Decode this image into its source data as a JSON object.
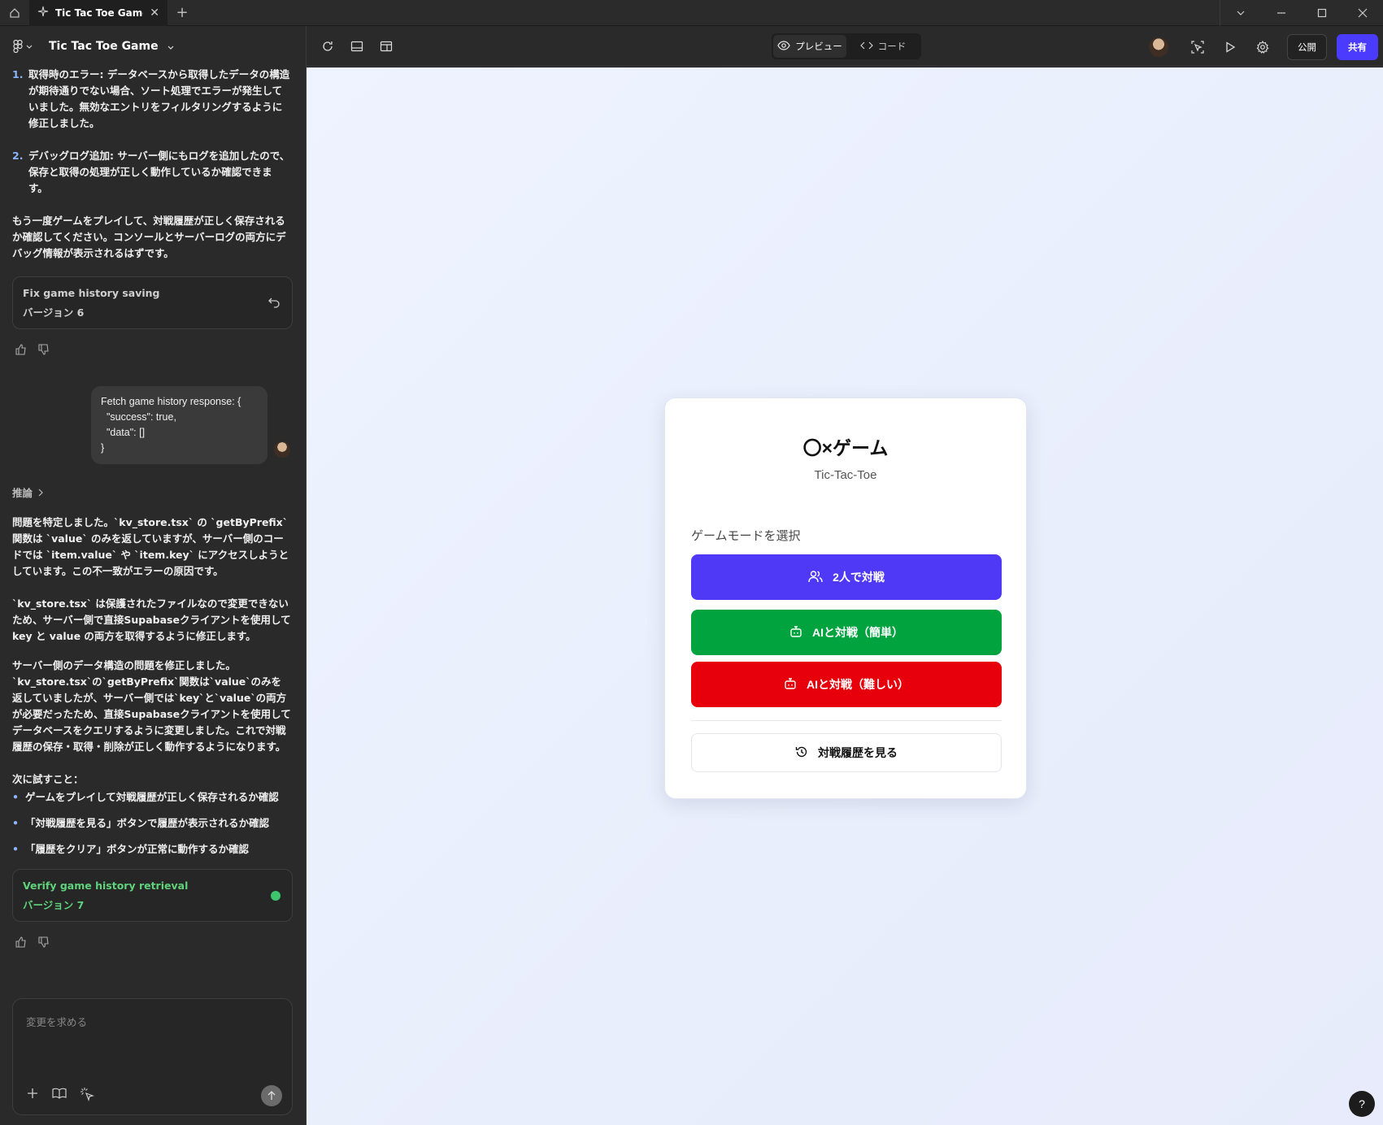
{
  "window": {
    "tab_title": "Tic Tac Toe Game"
  },
  "sidebar": {
    "project_name": "Tic Tac Toe Game",
    "messages": {
      "list1_num": "1.",
      "list1_strong": "取得時のエラー",
      "list1_text": ": データベースから取得したデータの構造が期待通りでない場合、ソート処理でエラーが発生していました。無効なエントリをフィルタリングするように修正しました。",
      "list2_num": "2.",
      "list2_strong": "デバッグログ追加",
      "list2_text": ": サーバー側にもログを追加したので、保存と取得の処理が正しく動作しているか確認できます。",
      "para1": "もう一度ゲームをプレイして、対戦履歴が正しく保存されるか確認してください。コンソールとサーバーログの両方にデバッグ情報が表示されるはずです。"
    },
    "version6": {
      "title": "Fix game history saving",
      "version": "バージョン 6"
    },
    "user_message": "Fetch game history response: {\n  \"success\": true,\n  \"data\": []\n}",
    "reasoning_label": "推論",
    "reply": {
      "p1": "問題を特定しました。`kv_store.tsx` の `getByPrefix` 関数は `value` のみを返していますが、サーバー側のコードでは `item.value` や `item.key` にアクセスしようとしています。この不一致がエラーの原因です。",
      "p2": "`kv_store.tsx` は保護されたファイルなので変更できないため、サーバー側で直接Supabaseクライアントを使用してkey と value の両方を取得するように修正します。",
      "p3": "サーバー側のデータ構造の問題を修正しました。`kv_store.tsx`の`getByPrefix`関数は`value`のみを返していましたが、サーバー側では`key`と`value`の両方が必要だったため、直接Supabaseクライアントを使用してデータベースをクエリするように変更しました。これで対戦履歴の保存・取得・削除が正しく動作するようになります。",
      "next_title": "次に試すこと：",
      "bullets": [
        "ゲームをプレイして対戦履歴が正しく保存されるか確認",
        "「対戦履歴を見る」ボタンで履歴が表示されるか確認",
        "「履歴をクリア」ボタンが正常に動作するか確認"
      ]
    },
    "version7": {
      "title": "Verify game history retrieval",
      "version": "バージョン 7"
    },
    "input_placeholder": "変更を求める"
  },
  "topbar": {
    "preview_label": "プレビュー",
    "code_label": "コード",
    "publish_label": "公開",
    "share_label": "共有"
  },
  "game": {
    "title": "〇×ゲーム",
    "subtitle": "Tic-Tac-Toe",
    "mode_label": "ゲームモードを選択",
    "btn_two_player": "2人で対戦",
    "btn_ai_easy": "AIと対戦（簡単）",
    "btn_ai_hard": "AIと対戦（難しい）",
    "btn_history": "対戦履歴を見る"
  },
  "help_label": "?",
  "colors": {
    "primary": "#4f39f6",
    "green": "#00a33e",
    "red": "#e7000b",
    "share": "#4b3bff"
  }
}
